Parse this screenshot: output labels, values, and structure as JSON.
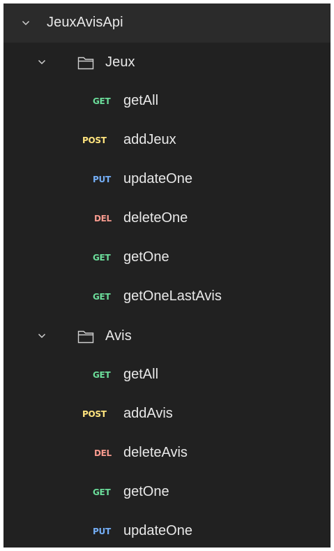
{
  "colors": {
    "GET": "#6bdd9a",
    "POST": "#ffe47e",
    "PUT": "#74aef6",
    "DEL": "#f79a8e"
  },
  "collection": {
    "name": "JeuxAvisApi",
    "expanded": true,
    "icon": "chevron-down-icon"
  },
  "folders": [
    {
      "name": "Jeux",
      "icon": "folder-icon",
      "expanded": true,
      "requests": [
        {
          "method": "GET",
          "name": "getAll"
        },
        {
          "method": "POST",
          "name": "addJeux"
        },
        {
          "method": "PUT",
          "name": "updateOne"
        },
        {
          "method": "DEL",
          "name": "deleteOne"
        },
        {
          "method": "GET",
          "name": "getOne"
        },
        {
          "method": "GET",
          "name": "getOneLastAvis"
        }
      ]
    },
    {
      "name": "Avis",
      "icon": "folder-icon",
      "expanded": true,
      "requests": [
        {
          "method": "GET",
          "name": "getAll"
        },
        {
          "method": "POST",
          "name": "addAvis"
        },
        {
          "method": "DEL",
          "name": "deleteAvis"
        },
        {
          "method": "GET",
          "name": "getOne"
        },
        {
          "method": "PUT",
          "name": "updateOne"
        }
      ]
    }
  ]
}
